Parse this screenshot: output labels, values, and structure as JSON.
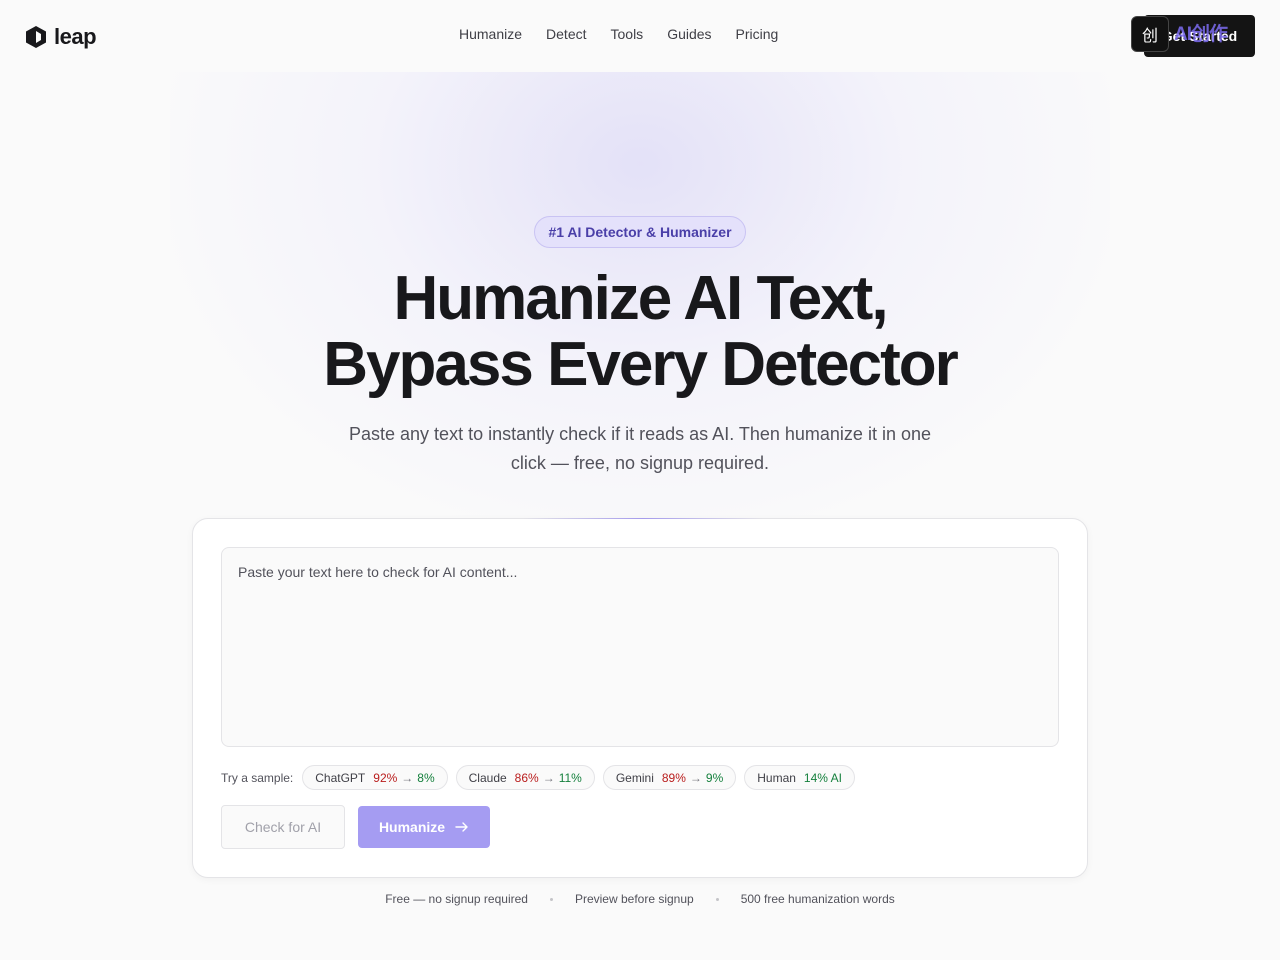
{
  "brand": {
    "name": "leap"
  },
  "nav": {
    "items": [
      "Humanize",
      "Detect",
      "Tools",
      "Guides",
      "Pricing"
    ],
    "cta_label": "Get Started"
  },
  "overlay": {
    "badge_text": "创",
    "label": "AI创作"
  },
  "hero": {
    "pill": "#1 AI Detector & Humanizer",
    "title_line1": "Humanize AI Text,",
    "title_line2": "Bypass Every Detector",
    "subtitle": "Paste any text to instantly check if it reads as AI. Then humanize it in one click — free, no signup required."
  },
  "editor": {
    "placeholder": "Paste your text here to check for AI content...",
    "value": ""
  },
  "samples": {
    "label": "Try a sample:",
    "items": [
      {
        "name": "ChatGPT",
        "before": "92%",
        "arrow": "→",
        "after": "8%"
      },
      {
        "name": "Claude",
        "before": "86%",
        "arrow": "→",
        "after": "11%"
      },
      {
        "name": "Gemini",
        "before": "89%",
        "arrow": "→",
        "after": "9%"
      },
      {
        "name": "Human",
        "score": "14% AI"
      }
    ]
  },
  "actions": {
    "check_label": "Check for AI",
    "humanize_label": "Humanize"
  },
  "notes": [
    "Free — no signup required",
    "Preview before signup",
    "500 free humanization words"
  ],
  "colors": {
    "accent": "#a59cf2",
    "accent_dark": "#4a3fa8",
    "high_ai": "#b91c1c",
    "low_ai": "#15803d"
  }
}
